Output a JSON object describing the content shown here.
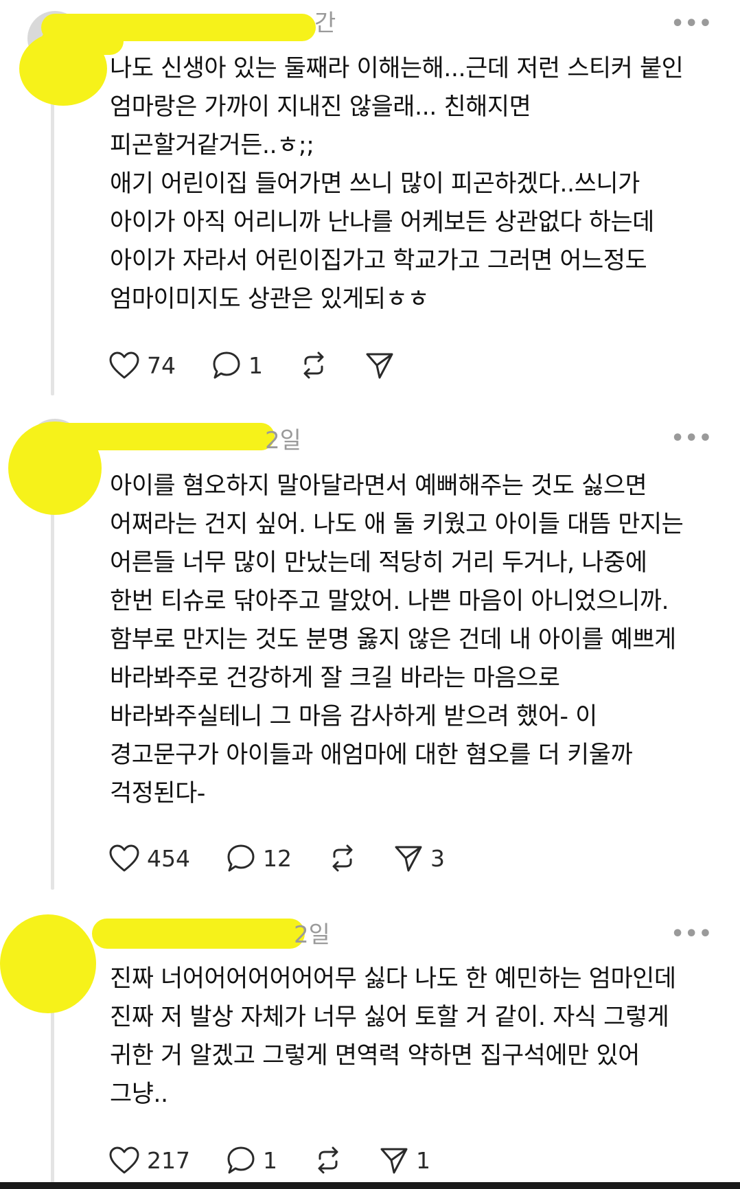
{
  "posts": [
    {
      "time": "간",
      "more_label": "•••",
      "body": "나도 신생아 있는 둘째라 이해는해...근데 저런 스티커 붙인\n엄마랑은 가까이 지내진 않을래... 친해지면\n피곤할거같거든..ㅎ;;\n애기 어린이집 들어가면 쓰니 많이 피곤하겠다..쓰니가\n아이가 아직 어리니까 난나를 어케보든 상관없다 하는데\n아이가 자라서 어린이집가고 학교가고 그러면 어느정도\n엄마이미지도 상관은 있게되ㅎㅎ",
      "likes": "74",
      "replies": "1",
      "reposts": "",
      "shares": ""
    },
    {
      "time": "2일",
      "more_label": "•••",
      "body": "아이를 혐오하지 말아달라면서 예뻐해주는 것도 싫으면\n어쩌라는 건지 싶어. 나도 애 둘 키웠고 아이들 대뜸 만지는\n어른들 너무 많이 만났는데 적당히 거리 두거나, 나중에\n한번 티슈로 닦아주고 말았어. 나쁜 마음이 아니었으니까.\n함부로 만지는 것도 분명 옳지 않은 건데 내 아이를 예쁘게\n바라봐주로 건강하게 잘 크길 바라는 마음으로\n바라봐주실테니 그 마음 감사하게 받으려 했어- 이\n경고문구가 아이들과 애엄마에 대한 혐오를 더 키울까\n걱정된다-",
      "likes": "454",
      "replies": "12",
      "reposts": "",
      "shares": "3"
    },
    {
      "time": "2일",
      "more_label": "•••",
      "body": "진짜 너어어어어어어어무 싫다 나도 한 예민하는 엄마인데\n진짜 저 발상 자체가 너무 싫어 토할 거 같이. 자식 그렇게\n귀한 거 알겠고 그렇게 면역력 약하면 집구석에만 있어\n그냥..",
      "likes": "217",
      "replies": "1",
      "reposts": "",
      "shares": "1"
    }
  ],
  "icons": {
    "like": "heart-icon",
    "reply": "comment-icon",
    "repost": "repost-icon",
    "share": "send-icon"
  },
  "colors": {
    "redaction": "#f6f21a",
    "meta_text": "#9a9a9a",
    "body_text": "#111111"
  }
}
